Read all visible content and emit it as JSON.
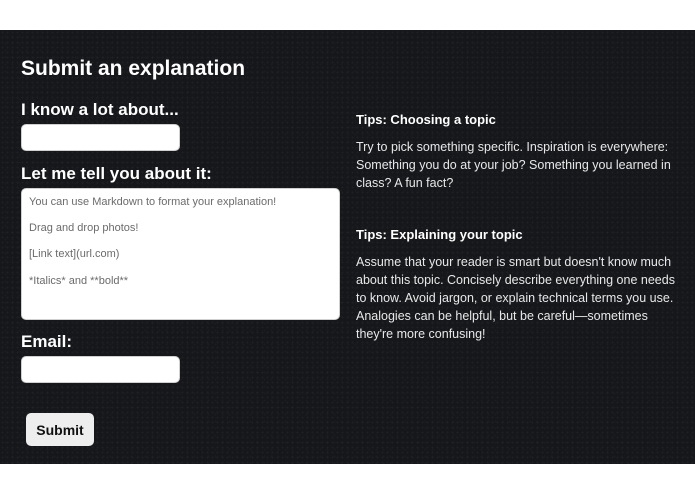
{
  "form": {
    "title": "Submit an explanation",
    "topic_label": "I know a lot about...",
    "topic_value": "",
    "explanation_label": "Let me tell you about it:",
    "explanation_placeholder": [
      "You can use Markdown to format your explanation!",
      "Drag and drop photos!",
      "[Link text](url.com)",
      "*Italics* and **bold**"
    ],
    "email_label": "Email:",
    "email_value": "",
    "submit_label": "Submit"
  },
  "tips": [
    {
      "heading": "Tips: Choosing a topic",
      "body": "Try to pick something specific. Inspiration is everywhere: Something you do at your job? Something you learned in class? A fun fact?"
    },
    {
      "heading": "Tips: Explaining your topic",
      "body": "Assume that your reader is smart but doesn't know much about this topic. Concisely describe everything one needs to know. Avoid jargon, or explain technical terms you use. Analogies can be helpful, but be careful—sometimes they're more confusing!"
    }
  ],
  "colors": {
    "panel_background": "#15171b",
    "text": "#ffffff",
    "input_background": "#ffffff",
    "button_background": "#eeeeee"
  }
}
